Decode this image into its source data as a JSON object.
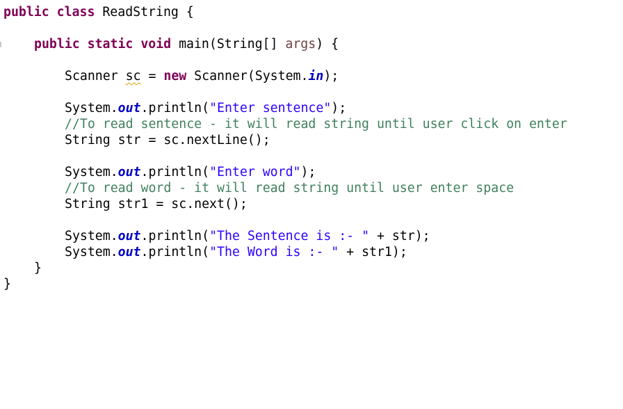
{
  "editor": {
    "lines": {
      "l1": {
        "kw1": "public",
        "kw2": "class",
        "rest": "ReadString {"
      },
      "l2": {
        "kw1": "public",
        "kw2": "static",
        "kw3": "void",
        "mid": "main(String[] ",
        "param": "args",
        "end": ") {"
      },
      "l3": {
        "a": "Scanner ",
        "var": "sc",
        "b": " = ",
        "kw": "new",
        "c": " Scanner(System.",
        "field": "in",
        "d": ");"
      },
      "l4": {
        "a": "System.",
        "field": "out",
        "b": ".println(",
        "str": "\"Enter sentence\"",
        "c": ");"
      },
      "l5": {
        "comment": "//To read sentence - it will read string until user click on enter"
      },
      "l6": {
        "text": "String str = sc.nextLine();"
      },
      "l7": {
        "a": "System.",
        "field": "out",
        "b": ".println(",
        "str": "\"Enter word\"",
        "c": ");"
      },
      "l8": {
        "comment": "//To read word - it will read string until user enter space"
      },
      "l9": {
        "text": "String str1 = sc.next();"
      },
      "l10": {
        "a": "System.",
        "field": "out",
        "b": ".println(",
        "str": "\"The Sentence is :- \"",
        "c": " + str);"
      },
      "l11": {
        "a": "System.",
        "field": "out",
        "b": ".println(",
        "str": "\"The Word is :- \"",
        "c": " + str1);"
      },
      "l12": {
        "text": "}"
      },
      "l13": {
        "text": "}"
      }
    },
    "colors": {
      "keyword": "#7f0055",
      "string": "#2a00ff",
      "static_field": "#0000c0",
      "parameter": "#6a3e3e",
      "comment": "#3f7f5f",
      "warning_squiggle": "#d2a000"
    }
  }
}
